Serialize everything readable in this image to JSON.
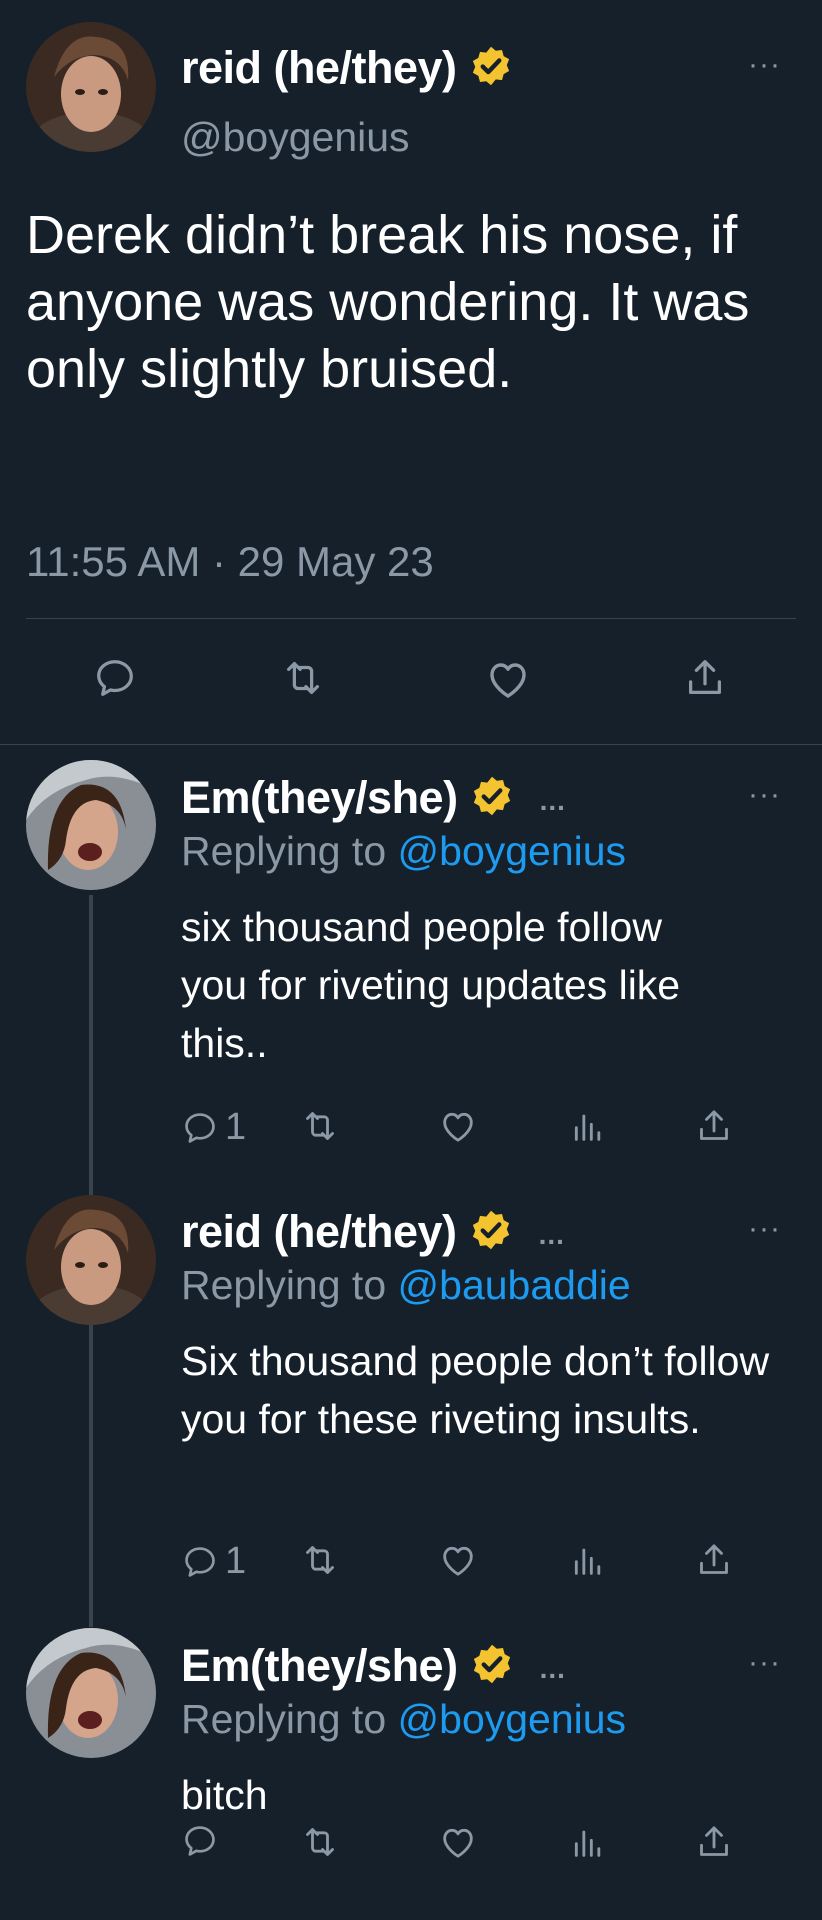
{
  "main_tweet": {
    "display_name": "reid (he/they)",
    "handle": "@boygenius",
    "text": "Derek didn’t break his nose, if anyone was wondering. It was only slightly bruised.",
    "timestamp": "11:55 AM · 29 May 23",
    "more": "···",
    "verified": true
  },
  "replies": [
    {
      "display_name": "Em(they/she)",
      "inline_ellipsis": "...",
      "replying_prefix": "Replying to ",
      "replying_handle": "@boygenius",
      "text": "six thousand people follow you for riveting updates like this..",
      "reply_count": "1",
      "more": "···",
      "verified": true
    },
    {
      "display_name": "reid (he/they)",
      "inline_ellipsis": "...",
      "replying_prefix": "Replying to ",
      "replying_handle": "@baubaddie",
      "text": "Six thousand people don’t follow you for these riveting insults.",
      "reply_count": "1",
      "more": "···",
      "verified": true
    },
    {
      "display_name": "Em(they/she)",
      "inline_ellipsis": "...",
      "replying_prefix": "Replying to ",
      "replying_handle": "@boygenius",
      "text": "bitch",
      "reply_count": "",
      "more": "···",
      "verified": true
    }
  ],
  "icons": {
    "reply": "speech-bubble-icon",
    "retweet": "retweet-icon",
    "like": "heart-icon",
    "views": "bar-chart-icon",
    "share": "share-icon",
    "verified": "verified-badge-icon"
  },
  "colors": {
    "background": "#15202b",
    "text": "#ffffff",
    "secondary_text": "#8b98a5",
    "link": "#1d9bf0",
    "verified_badge": "#f4c430",
    "divider": "#38444d"
  }
}
